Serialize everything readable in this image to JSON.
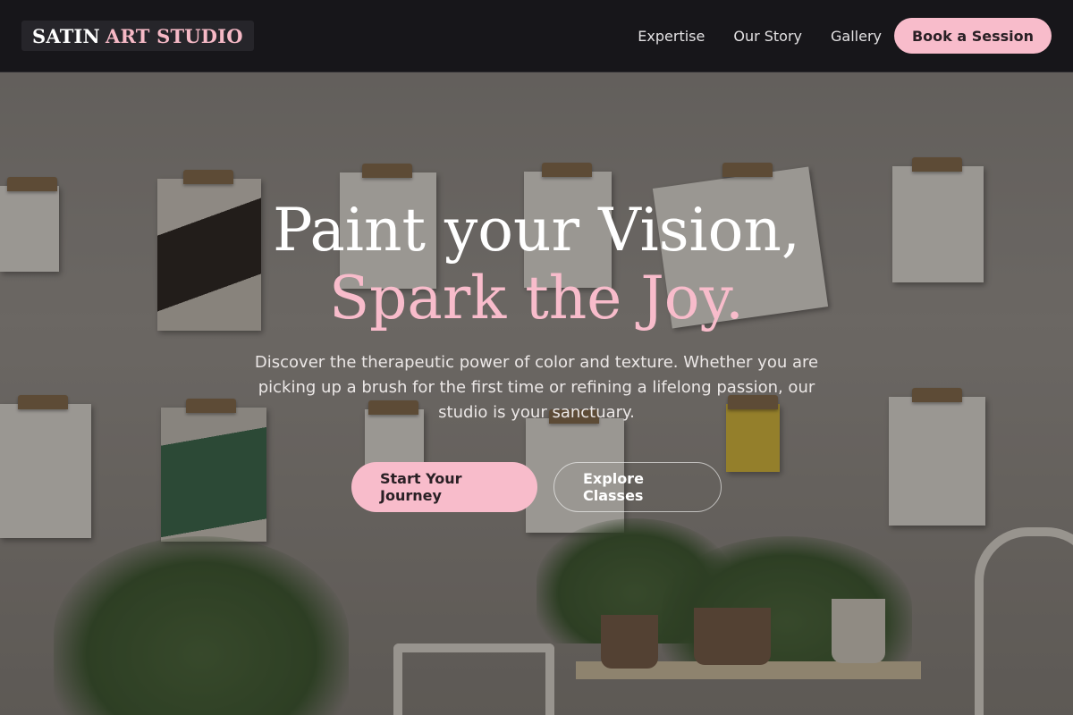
{
  "brand": {
    "name_part1": "SATIN",
    "name_part2": "ART STUDIO"
  },
  "nav": {
    "items": [
      "Expertise",
      "Our Story",
      "Gallery"
    ],
    "cta": "Book a Session"
  },
  "hero": {
    "headline_line1": "Paint your Vision,",
    "headline_line2": "Spark the Joy.",
    "lead": "Discover the therapeutic power of color and texture. Whether you are picking up a brush for the first time or refining a lifelong passion, our studio is your sanctuary.",
    "primary_cta": "Start Your Journey",
    "secondary_cta": "Explore Classes"
  },
  "colors": {
    "accent": "#f8bccb",
    "header_bg": "#17161a",
    "text_light": "#ffffff"
  }
}
